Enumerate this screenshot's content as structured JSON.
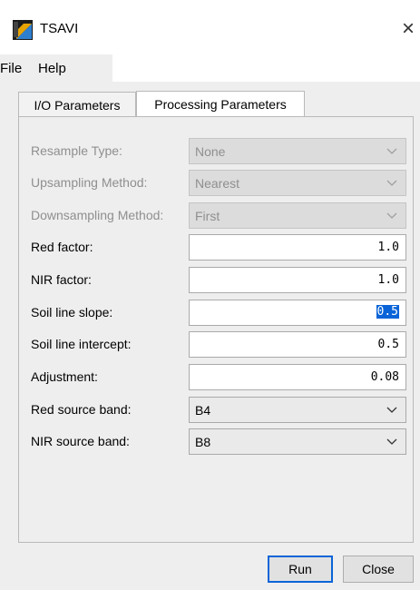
{
  "window": {
    "title": "TSAVI",
    "close_glyph": "×"
  },
  "menu": {
    "items": [
      "File",
      "Help"
    ]
  },
  "tabs": [
    "I/O Parameters",
    "Processing Parameters"
  ],
  "active_tab": "Processing Parameters",
  "params": {
    "resample_type": {
      "label": "Resample Type:",
      "value": "None"
    },
    "upsampling_method": {
      "label": "Upsampling Method:",
      "value": "Nearest"
    },
    "downsampling_method": {
      "label": "Downsampling Method:",
      "value": "First"
    },
    "red_factor": {
      "label": "Red factor:",
      "value": "1.0"
    },
    "nir_factor": {
      "label": "NIR factor:",
      "value": "1.0"
    },
    "soil_line_slope": {
      "label": "Soil line slope:",
      "value": "0.5"
    },
    "soil_line_intercept": {
      "label": "Soil line intercept:",
      "value": "0.5"
    },
    "adjustment": {
      "label": "Adjustment:",
      "value": "0.08"
    },
    "red_source_band": {
      "label": "Red source band:",
      "value": "B4"
    },
    "nir_source_band": {
      "label": "NIR source band:",
      "value": "B8"
    }
  },
  "buttons": {
    "run": "Run",
    "close": "Close"
  },
  "icons": {
    "app": "snap-app-icon",
    "dropdown": "chevron-down-icon"
  },
  "colors": {
    "selection": "#0a64d8",
    "disabled_text": "#8f8f8f"
  }
}
